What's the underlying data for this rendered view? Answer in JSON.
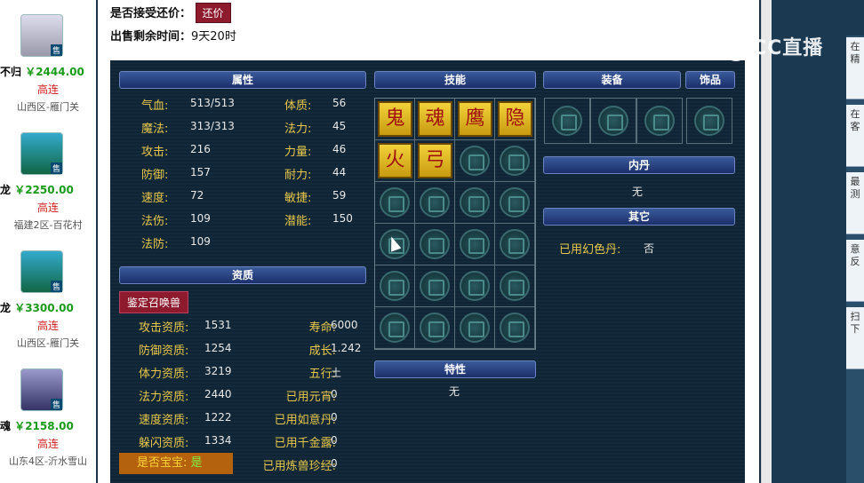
{
  "listing": [
    {
      "name": "不归",
      "price": "￥2444.00",
      "tag": "高连",
      "server": "山西区-雁门关",
      "badge": "售"
    },
    {
      "name": "龙",
      "price": "￥2250.00",
      "tag": "高连",
      "server": "福建2区-百花村",
      "badge": "售"
    },
    {
      "name": "龙",
      "price": "￥3300.00",
      "tag": "高连",
      "server": "山西区-雁门关",
      "badge": "售"
    },
    {
      "name": "魂",
      "price": "￥2158.00",
      "tag": "高连",
      "server": "山东4区-沂水雪山",
      "badge": "售"
    }
  ],
  "top": {
    "accept_label": "是否接受还价：",
    "accept_btn": "还价",
    "time_label": "出售剩余时间：",
    "time_value": "9天20时"
  },
  "watermark": "CC直播",
  "right_tabs": [
    "在精",
    "在客",
    "最测",
    "意反",
    "扫下"
  ],
  "headers": {
    "attr": "属性",
    "skill": "技能",
    "equip": "装备",
    "jewel": "饰品",
    "neidan": "内丹",
    "other": "其它",
    "aptitude": "资质",
    "trait": "特性"
  },
  "attrs_left": [
    {
      "k": "气血:",
      "v": "513/513"
    },
    {
      "k": "魔法:",
      "v": "313/313"
    },
    {
      "k": "攻击:",
      "v": "216"
    },
    {
      "k": "防御:",
      "v": "157"
    },
    {
      "k": "速度:",
      "v": "72"
    },
    {
      "k": "法伤:",
      "v": "109"
    },
    {
      "k": "法防:",
      "v": "109"
    }
  ],
  "attrs_right": [
    {
      "k": "体质:",
      "v": "56"
    },
    {
      "k": "法力:",
      "v": "45"
    },
    {
      "k": "力量:",
      "v": "46"
    },
    {
      "k": "耐力:",
      "v": "44"
    },
    {
      "k": "敏捷:",
      "v": "59"
    },
    {
      "k": "潜能:",
      "v": "150"
    }
  ],
  "identify_btn": "鉴定召唤兽",
  "apt_left": [
    {
      "k": "攻击资质:",
      "v": "1531"
    },
    {
      "k": "防御资质:",
      "v": "1254"
    },
    {
      "k": "体力资质:",
      "v": "3219"
    },
    {
      "k": "法力资质:",
      "v": "2440"
    },
    {
      "k": "速度资质:",
      "v": "1222"
    },
    {
      "k": "躲闪资质:",
      "v": "1334"
    }
  ],
  "apt_right": [
    {
      "k": "寿命:",
      "v": "6000"
    },
    {
      "k": "成长:",
      "v": "1.242"
    },
    {
      "k": "五行:",
      "v": "土"
    },
    {
      "k": "已用元宵:",
      "v": "0"
    },
    {
      "k": "已用如意丹:",
      "v": "0"
    },
    {
      "k": "已用千金露:",
      "v": "0"
    },
    {
      "k": "已用炼兽珍经:",
      "v": "0"
    }
  ],
  "baby": {
    "k": "是否宝宝:",
    "v": "是"
  },
  "neidan_value": "无",
  "other": {
    "k": "已用幻色丹:",
    "v": "否"
  },
  "trait_value": "无",
  "skills": [
    "鬼",
    "魂",
    "鹰",
    "隐",
    "火",
    "弓"
  ],
  "colors": {
    "accent_red": "#8e1a2e",
    "price_green": "#1a9b1a",
    "label_gold": "#e8c84a"
  }
}
